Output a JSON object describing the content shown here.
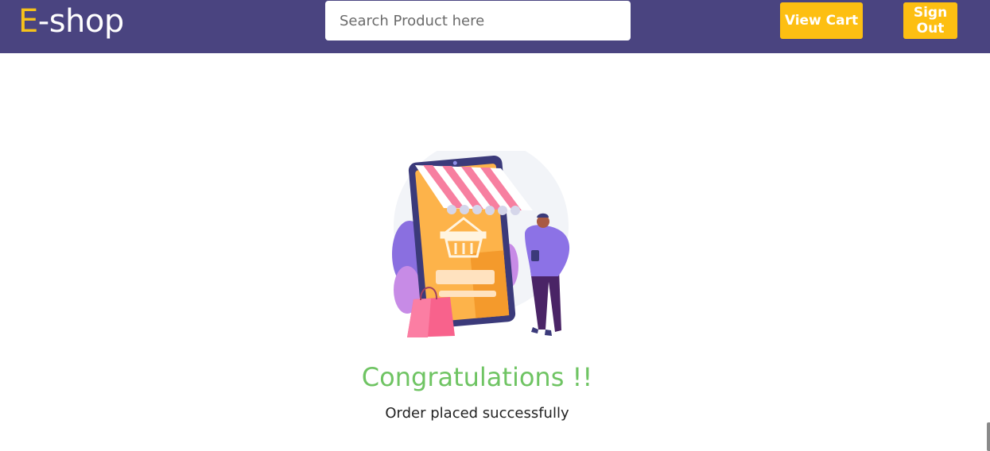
{
  "header": {
    "logo_first": "E",
    "logo_rest": "-shop",
    "search_placeholder": "Search Product here",
    "view_cart_label": "View Cart",
    "sign_out_label": "Sign Out"
  },
  "main": {
    "heading": "Congratulations !!",
    "message": "Order placed successfully",
    "illustration": "online-shopping-illustration"
  },
  "colors": {
    "navbar": "#4a4480",
    "accent": "#fdbf12",
    "success": "#6fc463"
  }
}
